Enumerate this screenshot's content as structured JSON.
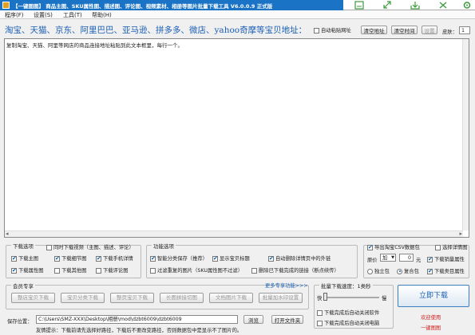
{
  "window": {
    "title": "【一键图图】 商品主图、SKU属性图、描述图、评论图、视频素材、相册等图片批量下载工具 V6.0.0.9 正式版"
  },
  "menu": [
    "程序(F)",
    "设置(S)",
    "工具(T)",
    "帮助(H)"
  ],
  "sites": "淘宝、天猫、京东、阿里巴巴、亚马逊、拼多多、微店、yahoo奇摩等宝贝地址：",
  "top_controls": {
    "auto_paste": "自动粘贴网址",
    "clean_url": "清空地址",
    "clean_time": "清空时间",
    "settings": "设置",
    "skin_label": "皮肤：",
    "skin_value": "1"
  },
  "input_hint": "复制淘宝、天猫、阿里等网店的商品连接地址粘贴到此文本框里，每行一个。",
  "download_options": {
    "legend": "下载选项",
    "sync_video": "同时下载视频（主图、描述、评论）",
    "items": [
      "下载主图",
      "下载细节图",
      "下载手机详情",
      "下载属性图",
      "下载其他图",
      "下载评论图"
    ]
  },
  "function_options": {
    "legend": "功能选项",
    "items": [
      "智能分类保存（推荐）",
      "显示宝贝标题",
      "自动删除详情页中的外链",
      "过滤重复的图片（SKU属性图不过滤）",
      "删除已下载完成的链接（断点续传）"
    ]
  },
  "right_options": {
    "export_csv": "导出淘宝CSV数据包",
    "select_detail": "选择详情图",
    "original_price": "原价",
    "op": "加",
    "op_value": "0",
    "unit": "元",
    "download_sales": "下载销量属性",
    "single_copy": "独立包",
    "merge_copy": "复合包",
    "download_class": "下载类目属性"
  },
  "member": {
    "legend": "会员专享",
    "more": "更多专享功能>>>",
    "buttons": [
      "整店宝贝下载",
      "宝贝分类下载",
      "整页宝贝下载",
      "长图拼接切图",
      "文档图片下载",
      "批量加水印设置"
    ]
  },
  "save": {
    "label": "保存位置：",
    "path": "C:\\Users\\SMZ-XXX\\Desktop\\相册\\mod\\dzbt6009\\dzbt6009",
    "browse": "浏览",
    "open": "打开文件夹"
  },
  "tip": "友情提示：下载前请先选择好路径，下载后不要改变路径，否则数据包中是显示不了图片的。",
  "speed": {
    "legend": "批量下载速度：1类秒",
    "slow": "快",
    "fast": "慢",
    "shutdown_close": "下载完成后自动关闭软件",
    "shutdown_pc": "下载完成后自动关闭电脑"
  },
  "start_button": "立即下载",
  "welcome": {
    "line1": "欢迎使用",
    "line2": "一键图图"
  }
}
